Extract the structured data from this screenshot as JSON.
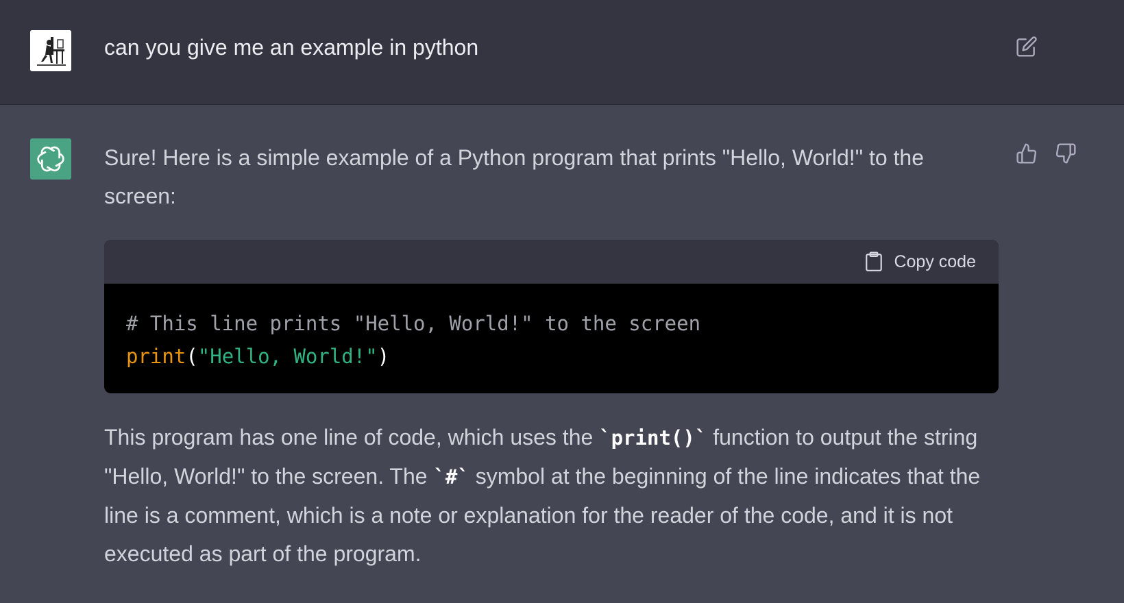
{
  "user_message": {
    "text": "can you give me an example in python"
  },
  "assistant_message": {
    "intro": "Sure! Here is a simple example of a Python program that prints \"Hello, World!\" to the screen:",
    "code_block": {
      "copy_label": "Copy code",
      "comment_line": "# This line prints \"Hello, World!\" to the screen",
      "func": "print",
      "open_paren": "(",
      "string": "\"Hello, World!\"",
      "close_paren": ")"
    },
    "explanation": {
      "part1": "This program has one line of code, which uses the ",
      "code1": "`print()`",
      "part2": " function to output the string \"Hello, World!\" to the screen. The ",
      "code2": "`#`",
      "part3": " symbol at the beginning of the line indicates that the line is a comment, which is a note or explanation for the reader of the code, and it is not executed as part of the program."
    }
  },
  "icons": {
    "edit": "edit-icon",
    "thumbs_up": "thumbs-up-icon",
    "thumbs_down": "thumbs-down-icon",
    "copy": "clipboard-icon",
    "bot_logo": "openai-logo-icon"
  },
  "colors": {
    "user_bg": "#343541",
    "assistant_bg": "#444654",
    "bot_avatar": "#4aa383",
    "code_bg": "#000000",
    "code_header_bg": "#343541",
    "code_function": "#e9950c",
    "code_string": "#2fb383",
    "code_comment": "#a1a1aa"
  }
}
